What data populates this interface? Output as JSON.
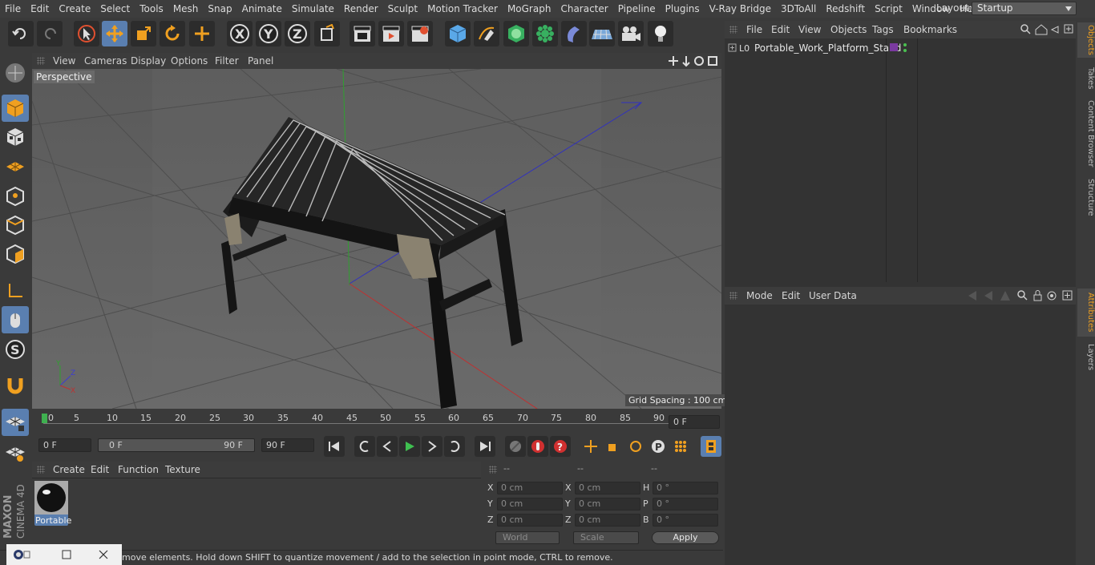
{
  "menu": [
    "File",
    "Edit",
    "Create",
    "Select",
    "Tools",
    "Mesh",
    "Snap",
    "Animate",
    "Simulate",
    "Render",
    "Sculpt",
    "Motion Tracker",
    "MoGraph",
    "Character",
    "Pipeline",
    "Plugins",
    "V-Ray Bridge",
    "3DToAll",
    "Redshift",
    "Script",
    "Window",
    "Help"
  ],
  "layout": {
    "label": "Layout:",
    "value": "Startup"
  },
  "viewport": {
    "menu": [
      "View",
      "Cameras",
      "Display",
      "Options",
      "Filter",
      "Panel"
    ],
    "label": "Perspective",
    "grid_spacing": "Grid Spacing : 100 cm"
  },
  "timeline": {
    "ticks": [
      "0",
      "5",
      "10",
      "15",
      "20",
      "25",
      "30",
      "35",
      "40",
      "45",
      "50",
      "55",
      "60",
      "65",
      "70",
      "75",
      "80",
      "85",
      "90"
    ],
    "current": "0 F",
    "start": "0 F",
    "range_start": "0 F",
    "range_end": "90 F",
    "end": "90 F"
  },
  "material": {
    "menu": [
      "Create",
      "Edit",
      "Function",
      "Texture"
    ],
    "item_label": "Portable"
  },
  "coords": {
    "headers": [
      "--",
      "--",
      "--"
    ],
    "rows": [
      {
        "l1": "X",
        "v1": "0 cm",
        "l2": "X",
        "v2": "0 cm",
        "l3": "H",
        "v3": "0 °"
      },
      {
        "l1": "Y",
        "v1": "0 cm",
        "l2": "Y",
        "v2": "0 cm",
        "l3": "P",
        "v3": "0 °"
      },
      {
        "l1": "Z",
        "v1": "0 cm",
        "l2": "Z",
        "v2": "0 cm",
        "l3": "B",
        "v3": "0 °"
      }
    ],
    "world": "World",
    "scale": "Scale",
    "apply": "Apply"
  },
  "status": "move elements. Hold down SHIFT to quantize movement / add to the selection in point mode, CTRL to remove.",
  "objects": {
    "menu": [
      "File",
      "Edit",
      "View",
      "Objects",
      "Tags",
      "Bookmarks"
    ],
    "items": [
      {
        "name": "Portable_Work_Platform_Stand"
      }
    ]
  },
  "attributes": {
    "menu": [
      "Mode",
      "Edit",
      "User Data"
    ]
  },
  "side_tabs": [
    "Objects",
    "Takes",
    "Content Browser",
    "Structure",
    "Attributes",
    "Layers"
  ],
  "brand": {
    "line1": "MAXON",
    "line2": "CINEMA 4D"
  },
  "colors": {
    "accent": "#5a7fb0",
    "viewport": "#5e5e5e"
  }
}
